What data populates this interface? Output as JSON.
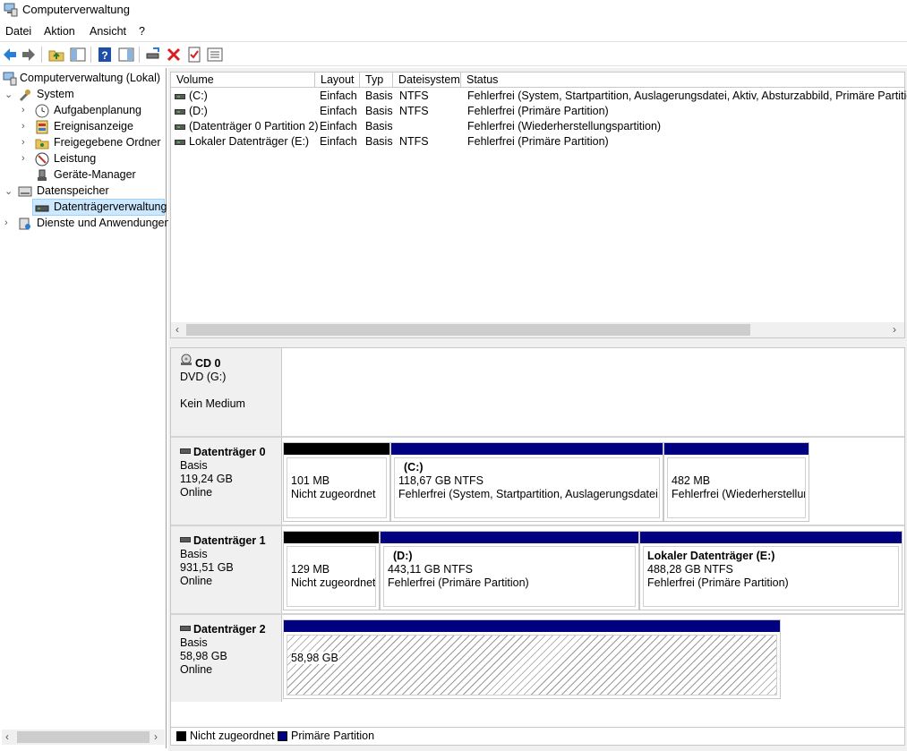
{
  "window": {
    "title": "Computerverwaltung"
  },
  "menu": [
    "Datei",
    "Aktion",
    "Ansicht",
    "?"
  ],
  "toolbar": {
    "buttons": [
      "back-icon",
      "forward-icon",
      "up-folder-icon",
      "show-hide-tree-icon",
      "help-icon",
      "action-pane-icon",
      "connect-drive-icon",
      "delete-icon",
      "properties-icon",
      "list-icon"
    ],
    "colors": {
      "delete": "#d81e1e",
      "help": "#1f4fa8",
      "nav": "#2a7fd4"
    }
  },
  "tree": {
    "root": "Computerverwaltung (Lokal)",
    "items": [
      {
        "label": "System",
        "level": 1,
        "expanded": true,
        "icon": "tools-icon"
      },
      {
        "label": "Aufgabenplanung",
        "level": 2,
        "icon": "clock-icon"
      },
      {
        "label": "Ereignisanzeige",
        "level": 2,
        "icon": "event-log-icon"
      },
      {
        "label": "Freigegebene Ordner",
        "level": 2,
        "icon": "shared-folder-icon"
      },
      {
        "label": "Leistung",
        "level": 2,
        "icon": "performance-icon"
      },
      {
        "label": "Geräte-Manager",
        "level": 2,
        "icon": "device-manager-icon"
      },
      {
        "label": "Datenspeicher",
        "level": 1,
        "expanded": true,
        "icon": "storage-icon"
      },
      {
        "label": "Datenträgerverwaltung",
        "level": 2,
        "selected": true,
        "icon": "disk-management-icon"
      },
      {
        "label": "Dienste und Anwendungen",
        "level": 1,
        "icon": "services-icon"
      }
    ]
  },
  "volumes": {
    "columns": [
      "Volume",
      "Layout",
      "Typ",
      "Dateisystem",
      "Status"
    ],
    "rows": [
      [
        "(C:)",
        "Einfach",
        "Basis",
        "NTFS",
        "Fehlerfrei (System, Startpartition, Auslagerungsdatei, Aktiv, Absturzabbild, Primäre Partition)"
      ],
      [
        "(D:)",
        "Einfach",
        "Basis",
        "NTFS",
        "Fehlerfrei (Primäre Partition)"
      ],
      [
        "(Datenträger 0 Partition 2)",
        "Einfach",
        "Basis",
        "",
        "Fehlerfrei (Wiederherstellungspartition)"
      ],
      [
        "Lokaler Datenträger (E:)",
        "Einfach",
        "Basis",
        "NTFS",
        "Fehlerfrei (Primäre Partition)"
      ]
    ]
  },
  "disks": [
    {
      "name": "CD 0",
      "lines": [
        "DVD (G:)",
        "",
        "Kein Medium"
      ]
    },
    {
      "name": "Datenträger 0",
      "lines": [
        "Basis",
        "119,24 GB",
        "Online"
      ],
      "partitions": [
        {
          "title": "",
          "size": "101 MB",
          "status": "Nicht zugeordnet",
          "kind": "unallocated"
        },
        {
          "title": "(C:)",
          "size": "118,67 GB NTFS",
          "status": "Fehlerfrei (System, Startpartition, Auslagerungsdatei, Al",
          "kind": "primary"
        },
        {
          "title": "",
          "size": "482 MB",
          "status": "Fehlerfrei (Wiederherstellung",
          "kind": "primary"
        }
      ]
    },
    {
      "name": "Datenträger 1",
      "lines": [
        "Basis",
        "931,51 GB",
        "Online"
      ],
      "partitions": [
        {
          "title": "",
          "size": "129 MB",
          "status": "Nicht zugeordnet",
          "kind": "unallocated"
        },
        {
          "title": "(D:)",
          "size": "443,11 GB NTFS",
          "status": "Fehlerfrei (Primäre Partition)",
          "kind": "primary"
        },
        {
          "title": "Lokaler Datenträger  (E:)",
          "size": "488,28 GB NTFS",
          "status": "Fehlerfrei (Primäre Partition)",
          "kind": "primary"
        }
      ]
    },
    {
      "name": "Datenträger 2",
      "lines": [
        "Basis",
        "58,98 GB",
        "Online"
      ],
      "partitions": [
        {
          "title": "",
          "size": "58,98 GB",
          "status": "",
          "kind": "primary-hatched"
        }
      ]
    }
  ],
  "legend": [
    {
      "label": "Nicht zugeordnet",
      "color": "#000000"
    },
    {
      "label": "Primäre Partition",
      "color": "#000080"
    }
  ],
  "colors": {
    "primary": "#000080",
    "unallocated": "#000000",
    "selection": "#cce8ff"
  }
}
